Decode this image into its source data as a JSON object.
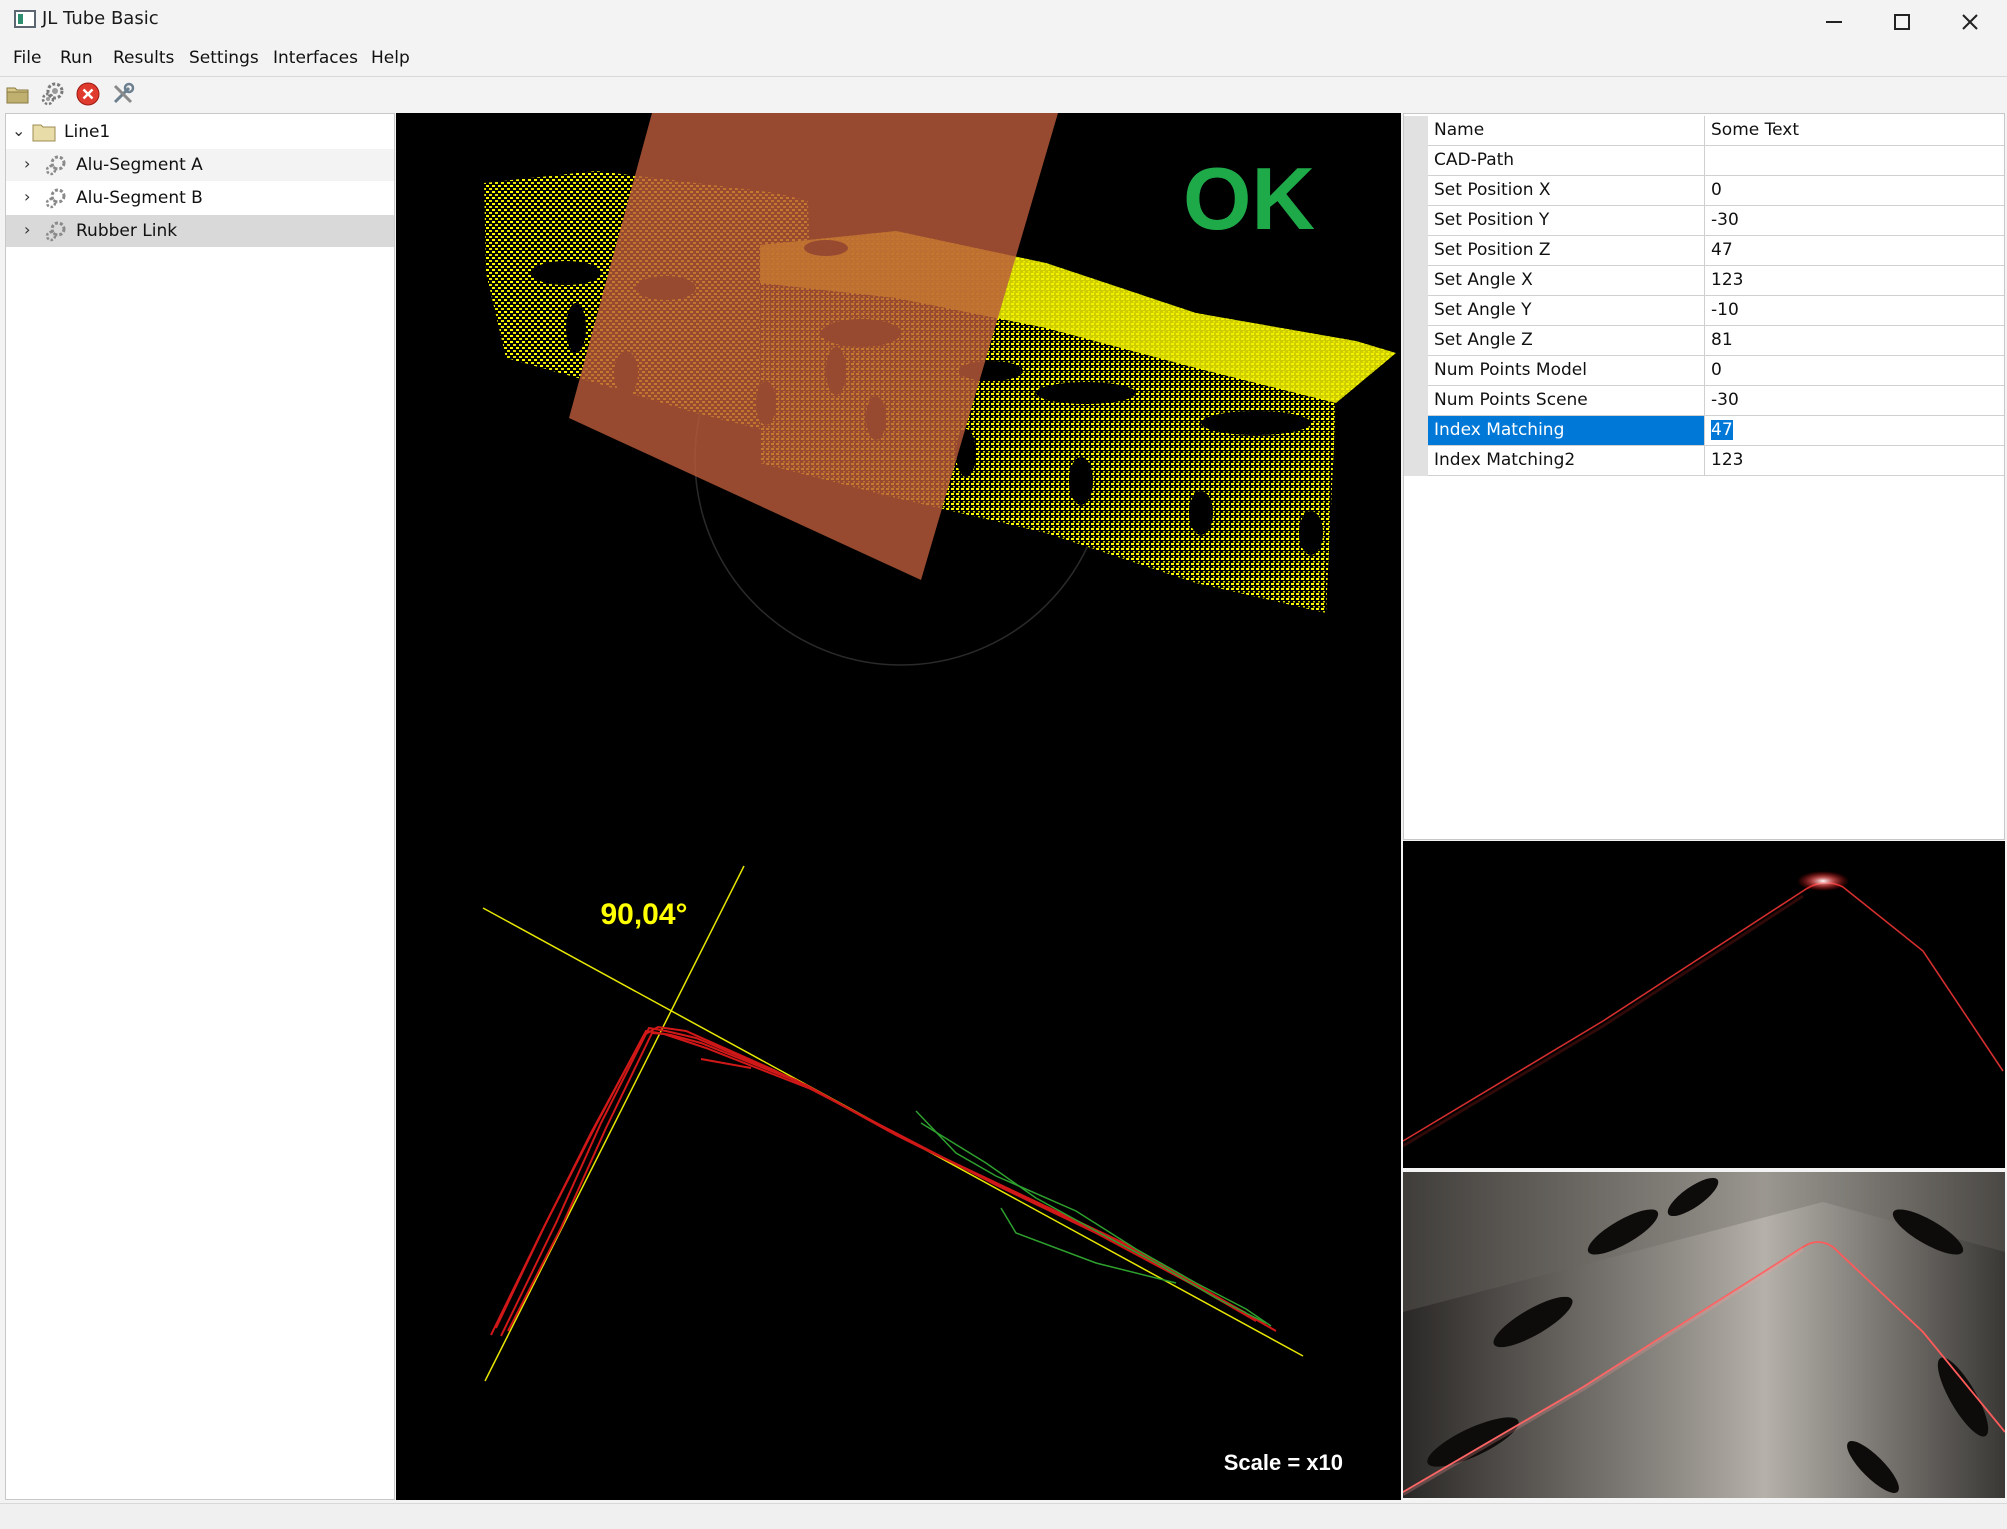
{
  "window": {
    "title": "JL Tube Basic"
  },
  "menu": [
    "File",
    "Run",
    "Results",
    "Settings",
    "Interfaces",
    "Help"
  ],
  "toolbar": [
    {
      "icon": "open-folder-icon"
    },
    {
      "icon": "gears-icon"
    },
    {
      "icon": "stop-icon"
    },
    {
      "icon": "tools-icon"
    }
  ],
  "tree": {
    "root": "Line1",
    "children": [
      "Alu-Segment A",
      "Alu-Segment B",
      "Rubber Link"
    ],
    "selected": "Rubber Link"
  },
  "viewer": {
    "status": "OK",
    "status_color": "#1faa4a",
    "angle_label": "90,04°",
    "scale_label": "Scale = x10",
    "point_cloud_color": "#ffff00",
    "plane_color": "#b85a3a"
  },
  "properties": [
    {
      "name": "Name",
      "value": "Some Text"
    },
    {
      "name": "CAD-Path",
      "value": ""
    },
    {
      "name": "Set Position X",
      "value": "0"
    },
    {
      "name": "Set Position Y",
      "value": "-30"
    },
    {
      "name": "Set Position Z",
      "value": "47"
    },
    {
      "name": "Set Angle X",
      "value": "123"
    },
    {
      "name": "Set Angle Y",
      "value": "-10"
    },
    {
      "name": "Set Angle Z",
      "value": "81"
    },
    {
      "name": "Num Points Model",
      "value": "0"
    },
    {
      "name": "Num Points Scene",
      "value": "-30"
    },
    {
      "name": "Index Matching",
      "value": "47",
      "selected": true
    },
    {
      "name": "Index Matching2",
      "value": "123"
    }
  ]
}
